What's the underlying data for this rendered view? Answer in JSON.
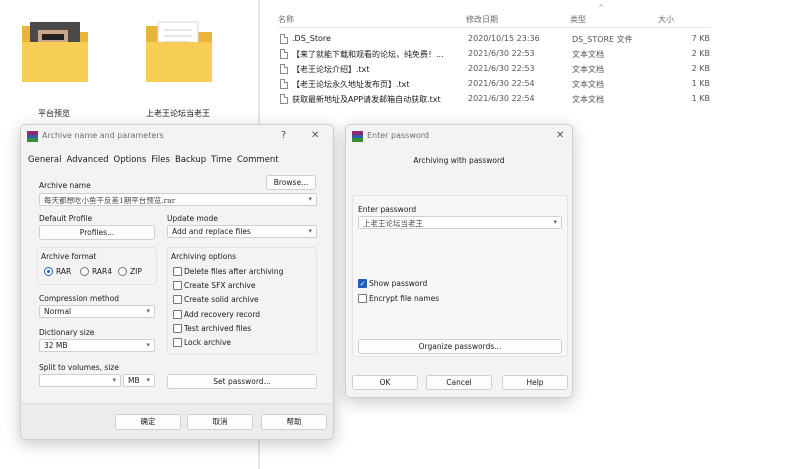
{
  "explorer": {
    "folders": [
      {
        "caption": "平台预览"
      },
      {
        "caption": "上老王论坛当老王"
      }
    ],
    "columns": {
      "name": "名称",
      "date": "修改日期",
      "type": "类型",
      "size": "大小"
    },
    "files": [
      {
        "name": ".DS_Store",
        "date": "2020/10/15 23:36",
        "type": "DS_STORE 文件",
        "size": "7 KB"
      },
      {
        "name": "【来了就能下载和观看的论坛，纯免费！...",
        "date": "2021/6/30 22:53",
        "type": "文本文档",
        "size": "2 KB"
      },
      {
        "name": "【老王论坛介绍】.txt",
        "date": "2021/6/30 22:53",
        "type": "文本文档",
        "size": "2 KB"
      },
      {
        "name": "【老王论坛永久地址发布页】.txt",
        "date": "2021/6/30 22:54",
        "type": "文本文档",
        "size": "1 KB"
      },
      {
        "name": "获取最新地址及APP请发邮箱自动获取.txt",
        "date": "2021/6/30 22:54",
        "type": "文本文档",
        "size": "1 KB"
      }
    ]
  },
  "archive_dialog": {
    "title": "Archive name and parameters",
    "help_glyph": "?",
    "close_glyph": "✕",
    "tabs": [
      "General",
      "Advanced",
      "Options",
      "Files",
      "Backup",
      "Time",
      "Comment"
    ],
    "archive_name_label": "Archive name",
    "browse_label": "Browse...",
    "archive_name_value": "每天都想吃小鱼干反差1期平台预览.rar",
    "default_profile_label": "Default Profile",
    "profiles_label": "Profiles...",
    "update_mode_label": "Update mode",
    "update_mode_value": "Add and replace files",
    "archive_format_label": "Archive format",
    "formats": [
      {
        "label": "RAR",
        "selected": true
      },
      {
        "label": "RAR4",
        "selected": false
      },
      {
        "label": "ZIP",
        "selected": false
      }
    ],
    "archiving_options_label": "Archiving options",
    "options": [
      {
        "label": "Delete files after archiving",
        "checked": false
      },
      {
        "label": "Create SFX archive",
        "checked": false
      },
      {
        "label": "Create solid archive",
        "checked": false
      },
      {
        "label": "Add recovery record",
        "checked": false
      },
      {
        "label": "Test archived files",
        "checked": false
      },
      {
        "label": "Lock archive",
        "checked": false
      }
    ],
    "compression_label": "Compression method",
    "compression_value": "Normal",
    "dictionary_label": "Dictionary size",
    "dictionary_value": "32 MB",
    "split_label": "Split to volumes, size",
    "split_value": "",
    "split_unit": "MB",
    "set_password_label": "Set password...",
    "ok_label": "确定",
    "cancel_label": "取消",
    "help_label": "帮助"
  },
  "password_dialog": {
    "title": "Enter password",
    "close_glyph": "✕",
    "heading": "Archiving with password",
    "enter_label": "Enter password",
    "password_value": "上老王论坛当老王",
    "show_password_label": "Show password",
    "show_password_checked": true,
    "encrypt_names_label": "Encrypt file names",
    "encrypt_names_checked": false,
    "organize_label": "Organize passwords...",
    "ok_label": "OK",
    "cancel_label": "Cancel",
    "help_label": "Help"
  },
  "colors": {
    "accent": "#1f5fb8",
    "folder": "#f3c64d",
    "dialog_bg": "#f3f3f3"
  },
  "icons": {
    "dropdown": "▾",
    "check": "✓",
    "file": "document-icon",
    "folder": "folder-icon",
    "winrar": "winrar-icon"
  }
}
